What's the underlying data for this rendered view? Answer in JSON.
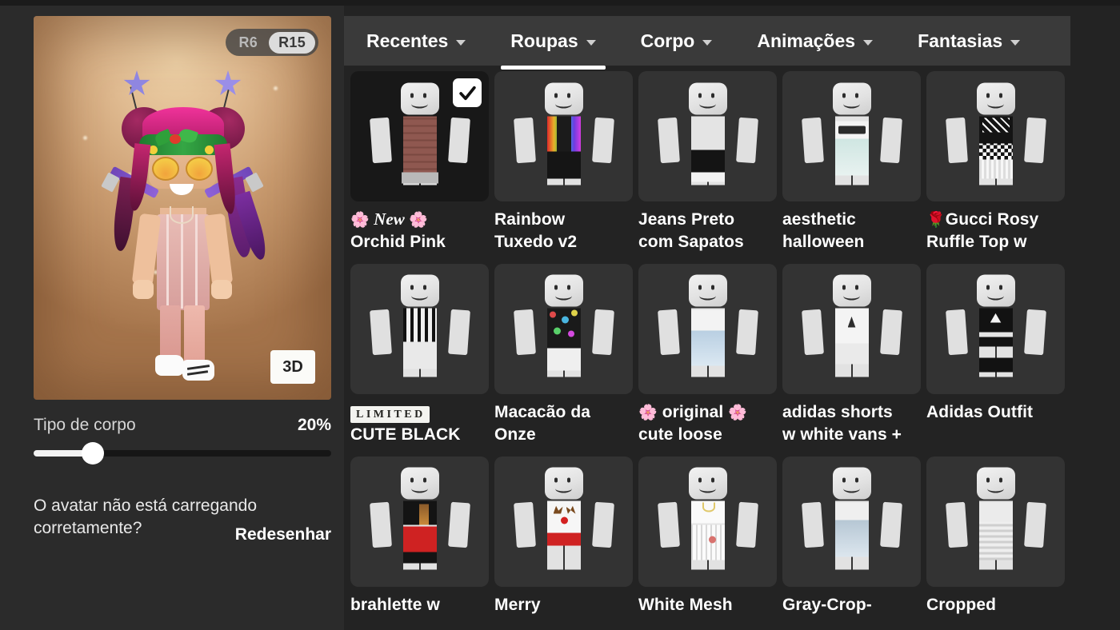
{
  "left": {
    "rig": {
      "options": [
        "R6",
        "R15"
      ],
      "selected": "R15"
    },
    "view_button": "3D",
    "body_type": {
      "label": "Tipo de corpo",
      "value": "20%",
      "percent": 20
    },
    "help": {
      "text": "O avatar não está carregando corretamente?",
      "action": "Redesenhar"
    }
  },
  "tabs": [
    {
      "label": "Recentes",
      "active": false
    },
    {
      "label": "Roupas",
      "active": true
    },
    {
      "label": "Corpo",
      "active": false
    },
    {
      "label": "Animações",
      "active": false
    },
    {
      "label": "Fantasias",
      "active": false
    }
  ],
  "grid": {
    "rows": [
      [
        {
          "badge": "new-flowers",
          "badge_text": "New",
          "line1": "Orchid Pink",
          "line2": "",
          "selected": true,
          "outfit": "orchid-plaid"
        },
        {
          "badge": "",
          "line1": "Rainbow",
          "line2": "Tuxedo v2",
          "selected": false,
          "outfit": "rainbow-tuxedo"
        },
        {
          "badge": "",
          "line1": "Jeans Preto",
          "line2": "com Sapatos",
          "selected": false,
          "outfit": "black-jeans"
        },
        {
          "badge": "",
          "line1": "aesthetic",
          "line2": "halloween",
          "selected": false,
          "outfit": "boo-mint"
        },
        {
          "badge": "rose",
          "line1": "Gucci Rosy",
          "line2": "Ruffle Top w",
          "selected": false,
          "outfit": "checker-black"
        }
      ],
      [
        {
          "badge": "limited",
          "badge_text": "LIMITED",
          "line1": "CUTE BLACK",
          "line2": "",
          "selected": false,
          "outfit": "striped-black"
        },
        {
          "badge": "",
          "line1": "Macacão da",
          "line2": "Onze",
          "selected": false,
          "outfit": "floral-dark"
        },
        {
          "badge": "flower-both",
          "badge_text": "original",
          "line1": "cute loose",
          "line2": "",
          "selected": false,
          "outfit": "denim-light"
        },
        {
          "badge": "",
          "line1": "adidas shorts",
          "line2": "w white vans +",
          "selected": false,
          "outfit": "adidas-white"
        },
        {
          "badge": "",
          "line1": "Adidas Outfit",
          "line2": "",
          "selected": false,
          "outfit": "adidas-black"
        }
      ],
      [
        {
          "badge": "",
          "line1": "brahlette w",
          "line2": "",
          "selected": false,
          "outfit": "red-skirt"
        },
        {
          "badge": "",
          "line1": "Merry",
          "line2": "",
          "selected": false,
          "outfit": "reindeer"
        },
        {
          "badge": "",
          "line1": "White Mesh",
          "line2": "",
          "selected": false,
          "outfit": "white-mesh"
        },
        {
          "badge": "",
          "line1": "Gray-Crop-",
          "line2": "",
          "selected": false,
          "outfit": "gray-crop"
        },
        {
          "badge": "",
          "line1": "Cropped",
          "line2": "",
          "selected": false,
          "outfit": "cropped-gray"
        }
      ]
    ]
  },
  "colors": {
    "panel_bg": "#2b2b2b",
    "grid_bg": "#232323",
    "tile_bg": "#333333",
    "tile_selected_bg": "#181818",
    "tabbar_bg": "#3a3a3a",
    "accent_white": "#ffffff",
    "avatar_bg_inner": "#edd0a6",
    "avatar_bg_outer": "#a5744b"
  }
}
